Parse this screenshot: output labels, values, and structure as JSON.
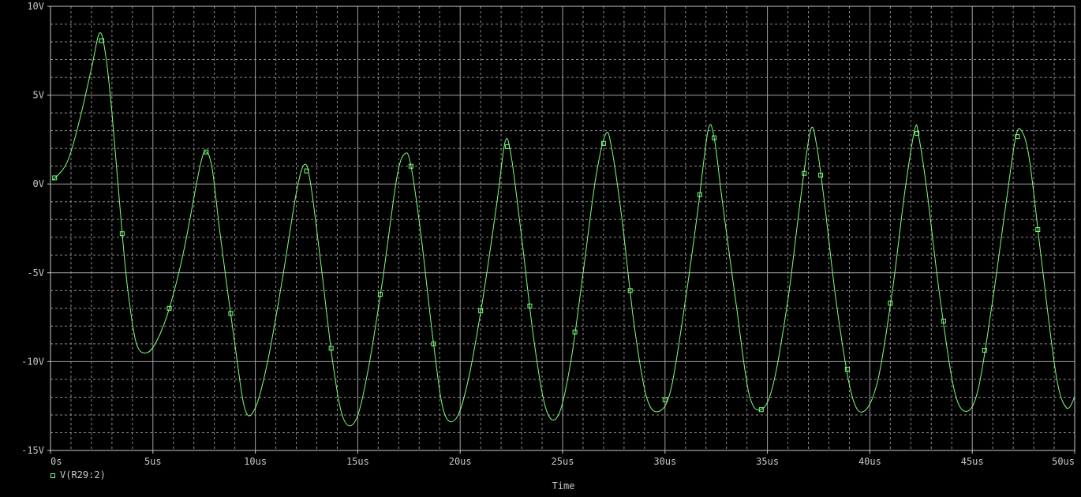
{
  "chart_data": {
    "type": "line",
    "xlabel": "Time",
    "ylabel": "",
    "xlim": [
      0,
      50
    ],
    "ylim": [
      -15,
      10
    ],
    "x_ticks": [
      0,
      5,
      10,
      15,
      20,
      25,
      30,
      35,
      40,
      45,
      50
    ],
    "x_tick_labels": [
      "0s",
      "5us",
      "10us",
      "15us",
      "20us",
      "25us",
      "30us",
      "35us",
      "40us",
      "45us",
      "50us"
    ],
    "y_ticks": [
      10,
      5,
      0,
      -5,
      -10,
      -15
    ],
    "y_tick_labels": [
      "10V",
      "5V",
      "0V",
      "-5V",
      "-10V",
      "-15V"
    ],
    "grid": true,
    "legend_position": "bottom-left",
    "colors": {
      "background": "#000000",
      "trace": "#7dff7d",
      "grid": "#8c8c8c",
      "axis": "#c8c8c8"
    },
    "series": [
      {
        "name": "V(R29:2)",
        "x": [
          0.1,
          0.8,
          1.4,
          2.0,
          2.4,
          2.7,
          3.0,
          3.5,
          3.8,
          4.2,
          4.7,
          5.2,
          5.8,
          6.5,
          7.3,
          7.6,
          7.9,
          8.3,
          9.0,
          9.5,
          10.0,
          10.6,
          11.3,
          12.0,
          12.4,
          12.7,
          13.2,
          13.8,
          14.3,
          14.9,
          15.5,
          16.2,
          16.9,
          17.3,
          17.6,
          18.1,
          18.7,
          19.2,
          19.8,
          20.4,
          21.1,
          21.8,
          22.2,
          22.5,
          23.0,
          23.6,
          24.2,
          24.8,
          25.4,
          26.0,
          26.6,
          27.1,
          27.4,
          27.9,
          28.5,
          29.1,
          29.7,
          30.3,
          31.0,
          31.6,
          32.1,
          32.4,
          32.8,
          33.5,
          34.1,
          34.7,
          35.3,
          36.0,
          36.6,
          37.1,
          37.4,
          37.8,
          38.4,
          39.1,
          39.7,
          40.4,
          41.1,
          41.7,
          42.2,
          42.4,
          42.8,
          43.4,
          44.1,
          44.7,
          45.3,
          46.0,
          46.6,
          47.1,
          47.4,
          47.8,
          48.4,
          49.1,
          49.6,
          50.0
        ],
        "y": [
          0.2,
          1.2,
          3.5,
          6.5,
          8.5,
          7.2,
          4.0,
          -2.8,
          -6.2,
          -9.0,
          -9.5,
          -8.8,
          -7.0,
          -3.8,
          1.0,
          1.8,
          0.8,
          -3.0,
          -9.0,
          -12.7,
          -12.6,
          -10.0,
          -5.5,
          -0.5,
          1.1,
          0.0,
          -4.5,
          -10.2,
          -13.2,
          -13.3,
          -10.5,
          -5.5,
          0.3,
          1.7,
          1.0,
          -3.0,
          -9.0,
          -12.8,
          -13.2,
          -11.0,
          -6.5,
          -1.0,
          2.4,
          1.5,
          -3.0,
          -8.8,
          -12.7,
          -13.0,
          -10.0,
          -5.0,
          0.2,
          2.8,
          2.0,
          -2.0,
          -8.0,
          -12.0,
          -12.8,
          -11.5,
          -6.5,
          -1.5,
          3.0,
          2.6,
          -1.0,
          -7.0,
          -11.8,
          -12.7,
          -11.2,
          -6.5,
          -1.0,
          3.0,
          2.2,
          -1.2,
          -7.0,
          -11.8,
          -12.8,
          -11.0,
          -6.0,
          -0.5,
          3.1,
          2.6,
          -0.5,
          -6.2,
          -11.5,
          -12.8,
          -11.5,
          -6.5,
          -1.5,
          2.5,
          3.0,
          1.3,
          -4.5,
          -10.8,
          -12.6,
          -12.0
        ],
        "marker_x": [
          0.2,
          2.5,
          3.5,
          5.8,
          7.6,
          8.8,
          12.5,
          13.7,
          16.1,
          17.6,
          18.7,
          21.0,
          22.3,
          23.4,
          25.6,
          27.0,
          28.3,
          30.0,
          31.7,
          32.4,
          34.7,
          36.8,
          37.6,
          38.9,
          41.0,
          42.3,
          43.6,
          45.6,
          47.2,
          48.2
        ]
      }
    ]
  }
}
